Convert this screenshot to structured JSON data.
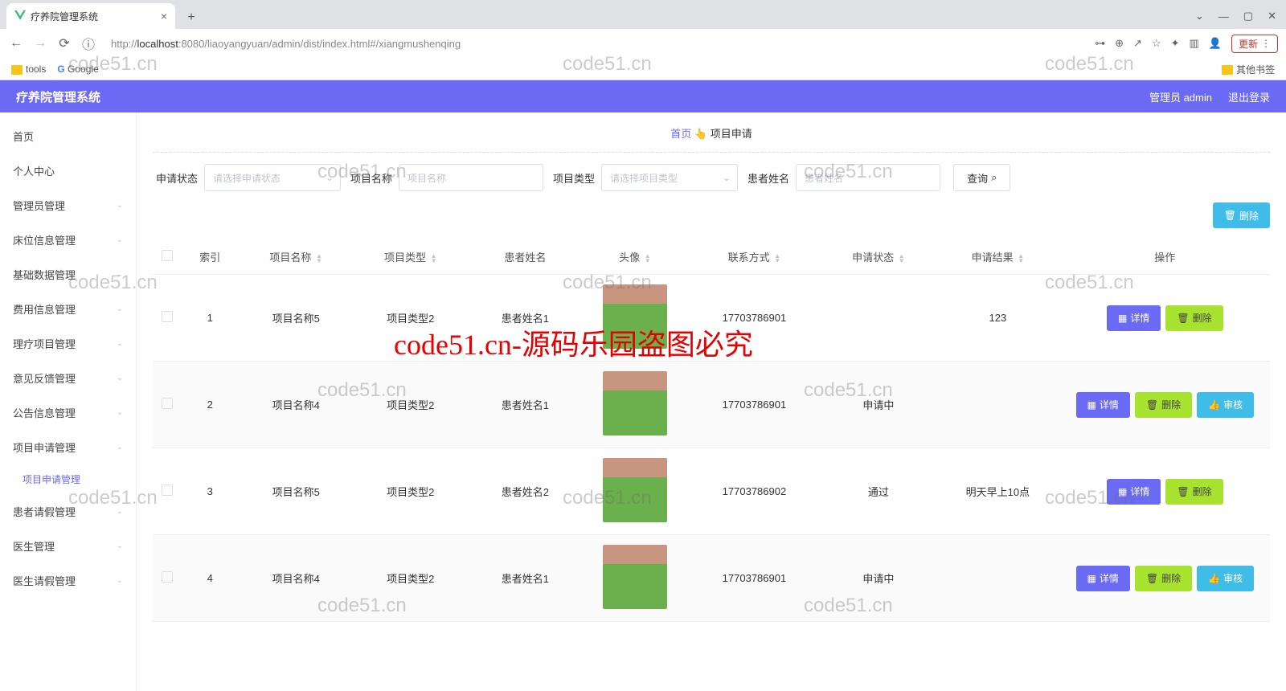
{
  "browser": {
    "tab_title": "疗养院管理系统",
    "url_host": "localhost",
    "url_prefix": "http://",
    "url_port": ":8080",
    "url_path": "/liaoyangyuan/admin/dist/index.html#/xiangmushenqing",
    "update_label": "更新",
    "bookmarks": {
      "tools": "tools",
      "google": "Google",
      "other": "其他书签"
    }
  },
  "header": {
    "brand": "疗养院管理系统",
    "user": "管理员 admin",
    "logout": "退出登录"
  },
  "sidebar": {
    "items": [
      {
        "label": "首页",
        "exp": false
      },
      {
        "label": "个人中心",
        "exp": false
      },
      {
        "label": "管理员管理",
        "exp": true
      },
      {
        "label": "床位信息管理",
        "exp": true
      },
      {
        "label": "基础数据管理",
        "exp": true
      },
      {
        "label": "费用信息管理",
        "exp": true
      },
      {
        "label": "理疗项目管理",
        "exp": true
      },
      {
        "label": "意见反馈管理",
        "exp": true
      },
      {
        "label": "公告信息管理",
        "exp": true
      },
      {
        "label": "项目申请管理",
        "exp": true,
        "sub": [
          {
            "label": "项目申请管理"
          }
        ]
      },
      {
        "label": "患者请假管理",
        "exp": true
      },
      {
        "label": "医生管理",
        "exp": true
      },
      {
        "label": "医生请假管理",
        "exp": true
      }
    ]
  },
  "crumb": {
    "home": "首页",
    "hand": "👆",
    "current": "项目申请"
  },
  "filters": {
    "status_label": "申请状态",
    "status_ph": "请选择申请状态",
    "name_label": "项目名称",
    "name_ph": "项目名称",
    "type_label": "项目类型",
    "type_ph": "请选择项目类型",
    "patient_label": "患者姓名",
    "patient_ph": "患者姓名",
    "query": "查询"
  },
  "toolbar": {
    "delete": "删除"
  },
  "columns": {
    "index": "索引",
    "name": "项目名称",
    "type": "项目类型",
    "patient": "患者姓名",
    "avatar": "头像",
    "contact": "联系方式",
    "status": "申请状态",
    "result": "申请结果",
    "ops": "操作"
  },
  "actions": {
    "detail": "详情",
    "delete": "删除",
    "audit": "审核"
  },
  "rows": [
    {
      "idx": "1",
      "name": "项目名称5",
      "type": "项目类型2",
      "patient": "患者姓名1",
      "contact": "17703786901",
      "status": "",
      "result": "123",
      "ops": [
        "detail",
        "delete"
      ]
    },
    {
      "idx": "2",
      "name": "项目名称4",
      "type": "项目类型2",
      "patient": "患者姓名1",
      "contact": "17703786901",
      "status": "申请中",
      "result": "",
      "ops": [
        "detail",
        "delete",
        "audit"
      ]
    },
    {
      "idx": "3",
      "name": "项目名称5",
      "type": "项目类型2",
      "patient": "患者姓名2",
      "contact": "17703786902",
      "status": "通过",
      "result": "明天早上10点",
      "ops": [
        "detail",
        "delete"
      ]
    },
    {
      "idx": "4",
      "name": "项目名称4",
      "type": "项目类型2",
      "patient": "患者姓名1",
      "contact": "17703786901",
      "status": "申请中",
      "result": "",
      "ops": [
        "detail",
        "delete",
        "audit"
      ]
    }
  ],
  "watermarks": {
    "text": "code51.cn",
    "red": "code51.cn-源码乐园盗图必究"
  }
}
